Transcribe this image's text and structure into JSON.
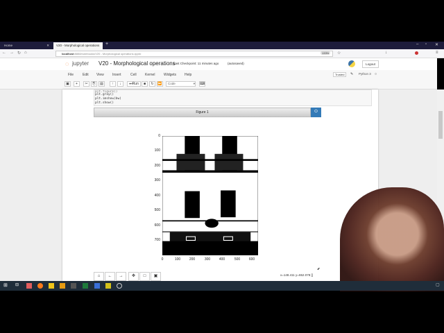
{
  "browser": {
    "tabs": [
      {
        "label": "Home"
      },
      {
        "label": "V20 - Morphological operations"
      }
    ],
    "url_host": "localhost",
    "url_rest": ":8888/notebooks/V20 - Morphological operations.ipynb",
    "zoom": "133%"
  },
  "jupyter": {
    "logo": "jupyter",
    "title": "V20 - Morphological operations",
    "checkpoint": "Last Checkpoint: 11 minutes ago",
    "autosaved": "(autosaved)",
    "logout": "Logout",
    "trusted": "Trusted",
    "kernel": "Python 3",
    "menu": [
      "File",
      "Edit",
      "View",
      "Insert",
      "Cell",
      "Kernel",
      "Widgets",
      "Help"
    ],
    "run_label": "Run",
    "cell_type": "Code"
  },
  "cell": {
    "lines": [
      "plt.gray()",
      "plt.imshow(bw)",
      "plt.show()"
    ]
  },
  "figure": {
    "title": "Figure 1",
    "coords": "x=148.411 y=652.078 []",
    "yticks": [
      "0",
      "100",
      "200",
      "300",
      "400",
      "500",
      "600",
      "700"
    ],
    "xticks": [
      "0",
      "100",
      "200",
      "300",
      "400",
      "500",
      "600"
    ]
  }
}
